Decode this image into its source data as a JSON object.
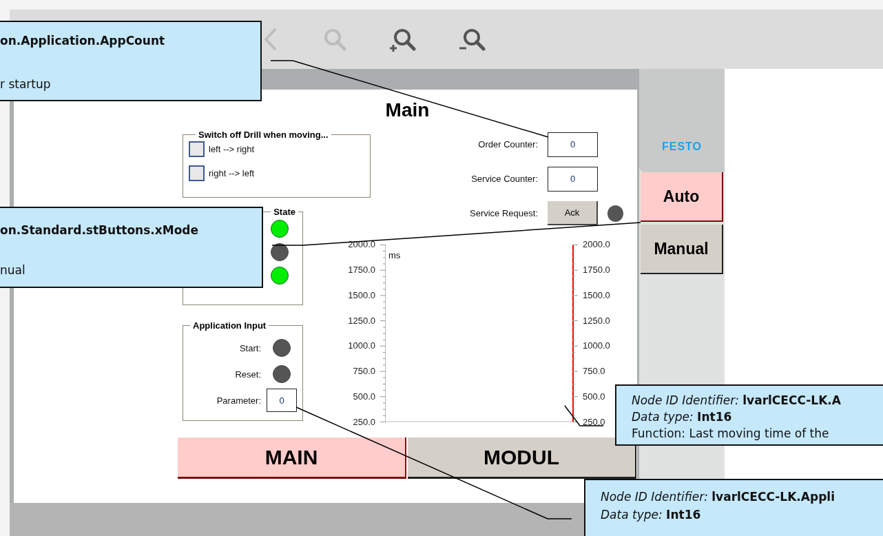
{
  "toolbar": {
    "buttons": [
      {
        "kind": "back",
        "disabled": true
      },
      {
        "kind": "zoom",
        "disabled": true
      },
      {
        "kind": "zoom_in",
        "disabled": false
      },
      {
        "kind": "zoom_out",
        "disabled": false
      }
    ]
  },
  "screen": {
    "title": "Main",
    "drill_group": {
      "title": "Switch off Drill when moving...",
      "options": [
        {
          "label": "left --> right",
          "checked": false
        },
        {
          "label": "right --> left",
          "checked": false
        }
      ]
    },
    "state_group": {
      "title": "State",
      "lamps": [
        {
          "on": true
        },
        {
          "on": false
        },
        {
          "on": true
        }
      ]
    },
    "input_group": {
      "title": "Application Input",
      "rows": [
        {
          "kind": "lamp",
          "label": "Start:",
          "on": false
        },
        {
          "kind": "lamp",
          "label": "Reset:",
          "on": false
        },
        {
          "kind": "field",
          "label": "Parameter:",
          "value": "0"
        }
      ]
    },
    "counters": [
      {
        "kind": "field",
        "label": "Order Counter:",
        "value": "0"
      },
      {
        "kind": "field",
        "label": "Service Counter:",
        "value": "0"
      },
      {
        "kind": "button",
        "label": "Service Request:",
        "button": "Ack",
        "on": false
      }
    ],
    "chart": {
      "unit": "ms",
      "left_ticks": [
        "2000.0",
        "1750.0",
        "1500.0",
        "1250.0",
        "1000.0",
        "750.0",
        "500.0",
        "250.0"
      ],
      "right_ticks": [
        "2000.0",
        "1750.0",
        "1500.0",
        "1250.0",
        "1000.0",
        "750.0",
        "500.0",
        "250.0"
      ]
    },
    "nav_tabs": [
      {
        "label": "MAIN",
        "selected": true
      },
      {
        "label": "MODUL",
        "selected": false
      }
    ]
  },
  "side_panel": {
    "logo": "FESTO",
    "modes": [
      {
        "label": "Auto",
        "selected": true
      },
      {
        "label": "Manual",
        "selected": false
      }
    ]
  },
  "callouts": [
    {
      "lines": [
        {
          "kind": "bold",
          "text": "on.Application.AppCount"
        },
        {
          "kind": "plain",
          "text": "r startup"
        }
      ]
    },
    {
      "lines": [
        {
          "kind": "bold",
          "text": "on.Standard.stButtons.xMode"
        },
        {
          "kind": "plain",
          "text": "nual"
        }
      ]
    },
    {
      "lines": [
        {
          "kind": "rich",
          "text": "*Node ID Identifier:* **lvarlCECC-LK.A**"
        },
        {
          "kind": "rich",
          "text": "*Data type:* **Int16**"
        },
        {
          "kind": "plain",
          "text": "Function: Last moving time of the"
        }
      ]
    },
    {
      "lines": [
        {
          "kind": "rich",
          "text": "*Node ID Identifier:* **lvarlCECC-LK.Appli**"
        },
        {
          "kind": "rich",
          "text": "*Data type:* **Int16**"
        }
      ]
    }
  ]
}
